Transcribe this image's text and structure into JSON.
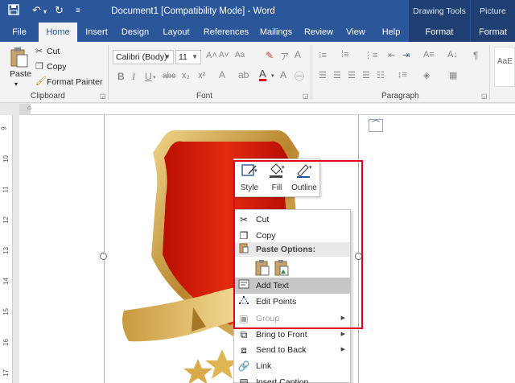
{
  "titlebar": {
    "doc_title": "Document1 [Compatibility Mode]  -  Word",
    "contextual": [
      "Drawing Tools",
      "Picture Tools"
    ],
    "qa_save": "💾",
    "qa_undo": "↶",
    "qa_redo": "↻",
    "qa_more": "≡"
  },
  "tabs": [
    "File",
    "Home",
    "Insert",
    "Design",
    "Layout",
    "References",
    "Mailings",
    "Review",
    "View",
    "Help",
    "Format",
    "Format"
  ],
  "active_tab": "Home",
  "ribbon": {
    "clipboard": {
      "paste": "Paste",
      "cut": "Cut",
      "copy": "Copy",
      "format_painter": "Format Painter",
      "label": "Clipboard"
    },
    "font": {
      "font_name": "Calibri (Body)",
      "font_size": "11",
      "label": "Font",
      "bold": "B",
      "italic": "I",
      "underline": "U",
      "strike": "abc",
      "sub": "x₂",
      "sup": "x²",
      "grow": "A˄",
      "shrink": "A˅",
      "case": "Aa",
      "font_color": "A"
    },
    "paragraph": {
      "label": "Paragraph"
    },
    "styles": {
      "preview": "AaE"
    }
  },
  "ruler": {
    "vertical_numbers": [
      "9",
      "10",
      "11",
      "12",
      "13",
      "14",
      "15",
      "16",
      "17"
    ]
  },
  "mini_toolbar": {
    "style": "Style",
    "fill": "Fill",
    "outline": "Outline"
  },
  "context_menu": {
    "items": [
      {
        "label": "Cut",
        "icon": "scissors-icon",
        "state": "normal"
      },
      {
        "label": "Copy",
        "icon": "copy-icon",
        "state": "normal"
      },
      {
        "label": "Paste Options:",
        "icon": "paste-icon",
        "state": "header"
      },
      {
        "label": "Add Text",
        "icon": "text-box-icon",
        "state": "highlighted"
      },
      {
        "label": "Edit Points",
        "icon": "edit-points-icon",
        "state": "normal"
      },
      {
        "label": "Group",
        "icon": "group-icon",
        "state": "disabled",
        "submenu": true
      },
      {
        "label": "Bring to Front",
        "icon": "bring-front-icon",
        "state": "normal",
        "submenu": true
      },
      {
        "label": "Send to Back",
        "icon": "send-back-icon",
        "state": "normal",
        "submenu": true
      },
      {
        "label": "Link",
        "icon": "link-icon",
        "state": "normal"
      },
      {
        "label": "Insert Caption...",
        "icon": "caption-icon",
        "state": "normal"
      }
    ]
  },
  "colors": {
    "word_blue": "#2b579a",
    "contextual_blue": "#1f3f72",
    "highlight_red": "#e3001b",
    "shield_red": "#d41e0b",
    "gold": "#d4a84b"
  }
}
